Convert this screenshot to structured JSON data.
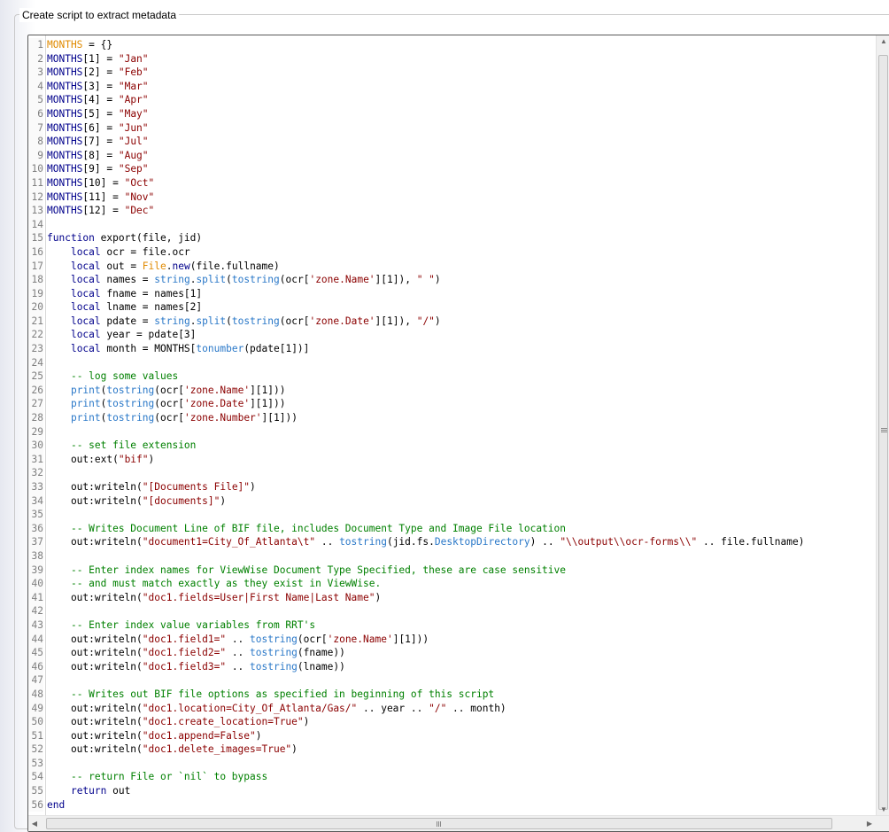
{
  "group": {
    "title": "Create script to extract metadata"
  },
  "editor": {
    "lines": [
      [
        {
          "t": "MONTHS",
          "c": "cls"
        },
        {
          "t": " = {}"
        }
      ],
      [
        {
          "t": "MONTHS",
          "c": "kw"
        },
        {
          "t": "[1] = "
        },
        {
          "t": "\"Jan\"",
          "c": "str"
        }
      ],
      [
        {
          "t": "MONTHS",
          "c": "kw"
        },
        {
          "t": "[2] = "
        },
        {
          "t": "\"Feb\"",
          "c": "str"
        }
      ],
      [
        {
          "t": "MONTHS",
          "c": "kw"
        },
        {
          "t": "[3] = "
        },
        {
          "t": "\"Mar\"",
          "c": "str"
        }
      ],
      [
        {
          "t": "MONTHS",
          "c": "kw"
        },
        {
          "t": "[4] = "
        },
        {
          "t": "\"Apr\"",
          "c": "str"
        }
      ],
      [
        {
          "t": "MONTHS",
          "c": "kw"
        },
        {
          "t": "[5] = "
        },
        {
          "t": "\"May\"",
          "c": "str"
        }
      ],
      [
        {
          "t": "MONTHS",
          "c": "kw"
        },
        {
          "t": "[6] = "
        },
        {
          "t": "\"Jun\"",
          "c": "str"
        }
      ],
      [
        {
          "t": "MONTHS",
          "c": "kw"
        },
        {
          "t": "[7] = "
        },
        {
          "t": "\"Jul\"",
          "c": "str"
        }
      ],
      [
        {
          "t": "MONTHS",
          "c": "kw"
        },
        {
          "t": "[8] = "
        },
        {
          "t": "\"Aug\"",
          "c": "str"
        }
      ],
      [
        {
          "t": "MONTHS",
          "c": "kw"
        },
        {
          "t": "[9] = "
        },
        {
          "t": "\"Sep\"",
          "c": "str"
        }
      ],
      [
        {
          "t": "MONTHS",
          "c": "kw"
        },
        {
          "t": "[10] = "
        },
        {
          "t": "\"Oct\"",
          "c": "str"
        }
      ],
      [
        {
          "t": "MONTHS",
          "c": "kw"
        },
        {
          "t": "[11] = "
        },
        {
          "t": "\"Nov\"",
          "c": "str"
        }
      ],
      [
        {
          "t": "MONTHS",
          "c": "kw"
        },
        {
          "t": "[12] = "
        },
        {
          "t": "\"Dec\"",
          "c": "str"
        }
      ],
      [],
      [
        {
          "t": "function",
          "c": "kw"
        },
        {
          "t": " export(file, jid)"
        }
      ],
      [
        {
          "t": "    "
        },
        {
          "t": "local",
          "c": "kw"
        },
        {
          "t": " ocr = file.ocr"
        }
      ],
      [
        {
          "t": "    "
        },
        {
          "t": "local",
          "c": "kw"
        },
        {
          "t": " out = "
        },
        {
          "t": "File",
          "c": "cls"
        },
        {
          "t": "."
        },
        {
          "t": "new",
          "c": "kw"
        },
        {
          "t": "(file.fullname)"
        }
      ],
      [
        {
          "t": "    "
        },
        {
          "t": "local",
          "c": "kw"
        },
        {
          "t": " names = "
        },
        {
          "t": "string",
          "c": "bi"
        },
        {
          "t": "."
        },
        {
          "t": "split",
          "c": "bi"
        },
        {
          "t": "("
        },
        {
          "t": "tostring",
          "c": "bi"
        },
        {
          "t": "(ocr["
        },
        {
          "t": "'zone.Name'",
          "c": "str"
        },
        {
          "t": "][1]), "
        },
        {
          "t": "\" \"",
          "c": "str"
        },
        {
          "t": ")"
        }
      ],
      [
        {
          "t": "    "
        },
        {
          "t": "local",
          "c": "kw"
        },
        {
          "t": " fname = names[1]"
        }
      ],
      [
        {
          "t": "    "
        },
        {
          "t": "local",
          "c": "kw"
        },
        {
          "t": " lname = names[2]"
        }
      ],
      [
        {
          "t": "    "
        },
        {
          "t": "local",
          "c": "kw"
        },
        {
          "t": " pdate = "
        },
        {
          "t": "string",
          "c": "bi"
        },
        {
          "t": "."
        },
        {
          "t": "split",
          "c": "bi"
        },
        {
          "t": "("
        },
        {
          "t": "tostring",
          "c": "bi"
        },
        {
          "t": "(ocr["
        },
        {
          "t": "'zone.Date'",
          "c": "str"
        },
        {
          "t": "][1]), "
        },
        {
          "t": "\"/\"",
          "c": "str"
        },
        {
          "t": ")"
        }
      ],
      [
        {
          "t": "    "
        },
        {
          "t": "local",
          "c": "kw"
        },
        {
          "t": " year = pdate[3]"
        }
      ],
      [
        {
          "t": "    "
        },
        {
          "t": "local",
          "c": "kw"
        },
        {
          "t": " month = MONTHS["
        },
        {
          "t": "tonumber",
          "c": "bi"
        },
        {
          "t": "(pdate[1])]"
        }
      ],
      [],
      [
        {
          "t": "    "
        },
        {
          "t": "-- log some values",
          "c": "cm"
        }
      ],
      [
        {
          "t": "    "
        },
        {
          "t": "print",
          "c": "bi"
        },
        {
          "t": "("
        },
        {
          "t": "tostring",
          "c": "bi"
        },
        {
          "t": "(ocr["
        },
        {
          "t": "'zone.Name'",
          "c": "str"
        },
        {
          "t": "][1]))"
        }
      ],
      [
        {
          "t": "    "
        },
        {
          "t": "print",
          "c": "bi"
        },
        {
          "t": "("
        },
        {
          "t": "tostring",
          "c": "bi"
        },
        {
          "t": "(ocr["
        },
        {
          "t": "'zone.Date'",
          "c": "str"
        },
        {
          "t": "][1]))"
        }
      ],
      [
        {
          "t": "    "
        },
        {
          "t": "print",
          "c": "bi"
        },
        {
          "t": "("
        },
        {
          "t": "tostring",
          "c": "bi"
        },
        {
          "t": "(ocr["
        },
        {
          "t": "'zone.Number'",
          "c": "str"
        },
        {
          "t": "][1]))"
        }
      ],
      [],
      [
        {
          "t": "    "
        },
        {
          "t": "-- set file extension",
          "c": "cm"
        }
      ],
      [
        {
          "t": "    out:ext("
        },
        {
          "t": "\"bif\"",
          "c": "str"
        },
        {
          "t": ")"
        }
      ],
      [],
      [
        {
          "t": "    out:writeln("
        },
        {
          "t": "\"[Documents File]\"",
          "c": "str"
        },
        {
          "t": ")"
        }
      ],
      [
        {
          "t": "    out:writeln("
        },
        {
          "t": "\"[documents]\"",
          "c": "str"
        },
        {
          "t": ")"
        }
      ],
      [],
      [
        {
          "t": "    "
        },
        {
          "t": "-- Writes Document Line of BIF file, includes Document Type and Image File location",
          "c": "cm"
        }
      ],
      [
        {
          "t": "    out:writeln("
        },
        {
          "t": "\"document1=City_Of_Atlanta\\t\"",
          "c": "str"
        },
        {
          "t": " .. "
        },
        {
          "t": "tostring",
          "c": "bi"
        },
        {
          "t": "(jid.fs."
        },
        {
          "t": "DesktopDirectory",
          "c": "bi"
        },
        {
          "t": ") .. "
        },
        {
          "t": "\"\\\\output\\\\ocr-forms\\\\\"",
          "c": "str"
        },
        {
          "t": " .. file.fullname)"
        }
      ],
      [],
      [
        {
          "t": "    "
        },
        {
          "t": "-- Enter index names for ViewWise Document Type Specified, these are case sensitive",
          "c": "cm"
        }
      ],
      [
        {
          "t": "    "
        },
        {
          "t": "-- and must match exactly as they exist in ViewWise.",
          "c": "cm"
        }
      ],
      [
        {
          "t": "    out:writeln("
        },
        {
          "t": "\"doc1.fields=User|First Name|Last Name\"",
          "c": "str"
        },
        {
          "t": ")"
        }
      ],
      [],
      [
        {
          "t": "    "
        },
        {
          "t": "-- Enter index value variables from RRT's",
          "c": "cm"
        }
      ],
      [
        {
          "t": "    out:writeln("
        },
        {
          "t": "\"doc1.field1=\"",
          "c": "str"
        },
        {
          "t": " .. "
        },
        {
          "t": "tostring",
          "c": "bi"
        },
        {
          "t": "(ocr["
        },
        {
          "t": "'zone.Name'",
          "c": "str"
        },
        {
          "t": "][1]))"
        }
      ],
      [
        {
          "t": "    out:writeln("
        },
        {
          "t": "\"doc1.field2=\"",
          "c": "str"
        },
        {
          "t": " .. "
        },
        {
          "t": "tostring",
          "c": "bi"
        },
        {
          "t": "(fname))"
        }
      ],
      [
        {
          "t": "    out:writeln("
        },
        {
          "t": "\"doc1.field3=\"",
          "c": "str"
        },
        {
          "t": " .. "
        },
        {
          "t": "tostring",
          "c": "bi"
        },
        {
          "t": "(lname))"
        }
      ],
      [],
      [
        {
          "t": "    "
        },
        {
          "t": "-- Writes out BIF file options as specified in beginning of this script",
          "c": "cm"
        }
      ],
      [
        {
          "t": "    out:writeln("
        },
        {
          "t": "\"doc1.location=City_Of_Atlanta/Gas/\"",
          "c": "str"
        },
        {
          "t": " .. year .. "
        },
        {
          "t": "\"/\"",
          "c": "str"
        },
        {
          "t": " .. month)"
        }
      ],
      [
        {
          "t": "    out:writeln("
        },
        {
          "t": "\"doc1.create_location=True\"",
          "c": "str"
        },
        {
          "t": ")"
        }
      ],
      [
        {
          "t": "    out:writeln("
        },
        {
          "t": "\"doc1.append=False\"",
          "c": "str"
        },
        {
          "t": ")"
        }
      ],
      [
        {
          "t": "    out:writeln("
        },
        {
          "t": "\"doc1.delete_images=True\"",
          "c": "str"
        },
        {
          "t": ")"
        }
      ],
      [],
      [
        {
          "t": "    "
        },
        {
          "t": "-- return File or `nil` to bypass",
          "c": "cm"
        }
      ],
      [
        {
          "t": "    "
        },
        {
          "t": "return",
          "c": "kw"
        },
        {
          "t": " out"
        }
      ],
      [
        {
          "t": "end",
          "c": "kw"
        }
      ]
    ]
  },
  "scrollbars": {
    "up_arrow": "▲",
    "down_arrow": "▼",
    "left_arrow": "◀",
    "right_arrow": "▶"
  }
}
